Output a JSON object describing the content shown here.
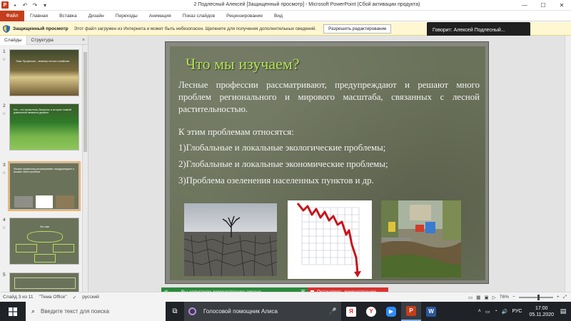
{
  "window": {
    "title": "2 Подлесный Алексей [Защищенный просмотр] - Microsoft PowerPoint (Сбой активации продукта)",
    "minimize": "—",
    "maximize": "☐",
    "close": "✕"
  },
  "ribbon": {
    "file": "Файл",
    "tabs": [
      "Главная",
      "Вставка",
      "Дизайн",
      "Переходы",
      "Анимация",
      "Показ слайдов",
      "Рецензирование",
      "Вид"
    ]
  },
  "protected_view": {
    "title": "Защищенный просмотр",
    "message": "Этот файл загружен из Интернета и может быть небезопасен. Щелкните для получения дополнительных сведений.",
    "button": "Разрешить редактирование"
  },
  "speaker": "Говорит: Алексей Подлесный...",
  "left_panel": {
    "tabs": [
      "Слайды",
      "Структура"
    ],
    "close": "×",
    "thumbnails": [
      {
        "num": "1",
        "text": "Тема: Профессия – инженер лесного хозяйства"
      },
      {
        "num": "2",
        "text": "Лес – это экосистема, биоценоз, в котором главной доминантой являются деревья"
      },
      {
        "num": "3",
        "text": "Лесные профессии рассматривают, предупреждают и решают много проблем"
      },
      {
        "num": "4",
        "text": "Лес нам"
      },
      {
        "num": "5",
        "text": ""
      }
    ]
  },
  "slide": {
    "title": "Что мы изучаем?",
    "paragraph": "Лесные профессии рассматривают, предупреждают и решают много проблем регионального и мирового масштаба, связанных с лесной растительностью.",
    "lines": [
      "К этим проблемам относятся:",
      "1)Глобальные и локальные экологические проблемы;",
      "2)Глобальные и локальные экономические проблемы;",
      "3)Проблема озеленения населенных пунктов и др."
    ]
  },
  "share_bar": {
    "message": "Вы запустили демонстрацию экрана",
    "stop": "Остановить демонстрацию"
  },
  "status": {
    "slide": "Слайд 3 из 11",
    "theme": "\"Тема Office\"",
    "language": "русский",
    "zoom": "76%",
    "zoom_fraction": 0.58
  },
  "taskbar": {
    "search_placeholder": "Введите текст для поиска",
    "alice": "Голосовой помощник Алиса",
    "lang": "РУС",
    "time": "17:00",
    "date": "05.11.2020"
  },
  "colors": {
    "accent_file": "#c43e1c",
    "slide_bg": "#6b725a",
    "slide_title": "#b4e05a",
    "share_green": "#2a8a3a",
    "share_red": "#d9322f"
  }
}
